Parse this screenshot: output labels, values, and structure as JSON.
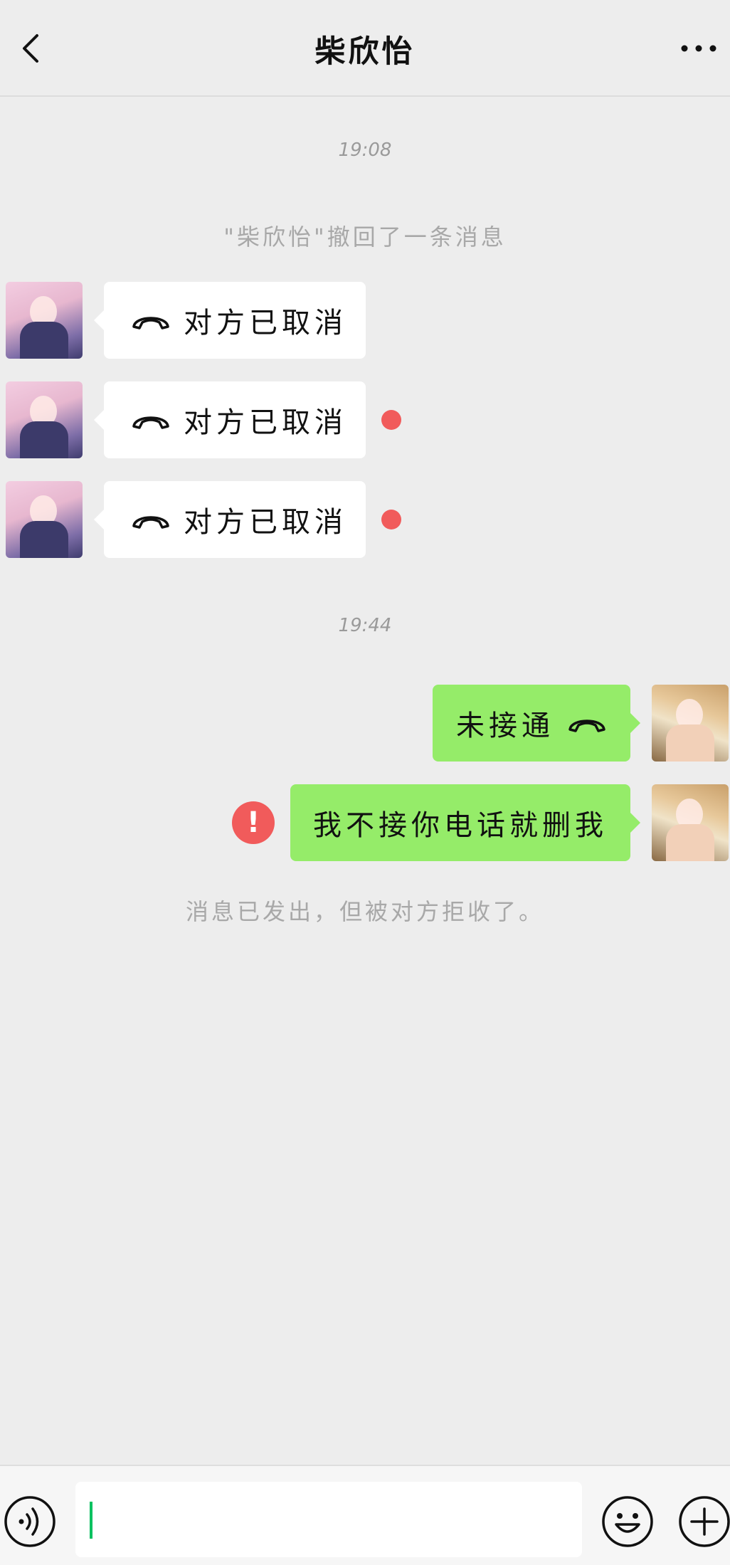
{
  "header": {
    "title": "柴欣怡"
  },
  "messages": {
    "time1": "19:08",
    "recall_notice": "\"柴欣怡\"撤回了一条消息",
    "incoming": [
      {
        "text": "对方已取消",
        "unread": false
      },
      {
        "text": "对方已取消",
        "unread": true
      },
      {
        "text": "对方已取消",
        "unread": true
      }
    ],
    "time2": "19:44",
    "outgoing": [
      {
        "text": "未接通"
      },
      {
        "text": "我不接你电话就删我",
        "failed": true,
        "error_mark": "!"
      }
    ],
    "rejected_notice": "消息已发出，但被对方拒收了。"
  },
  "input": {
    "value": ""
  },
  "colors": {
    "background": "#ededed",
    "outgoing_bubble": "#95ec69",
    "incoming_bubble": "#ffffff",
    "error_red": "#f15b5b",
    "caret_green": "#07c160"
  }
}
